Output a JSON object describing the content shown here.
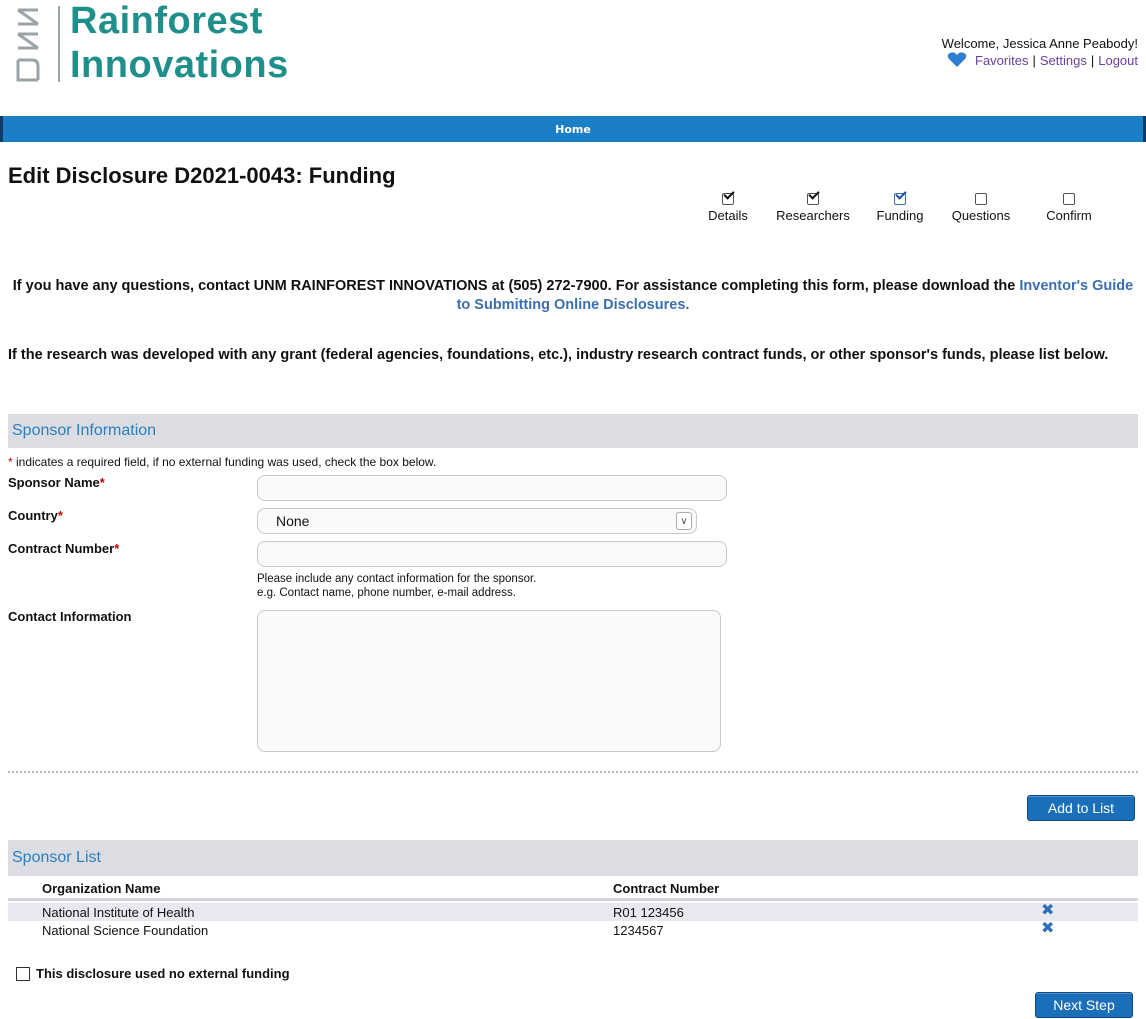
{
  "header": {
    "logo_mark": "UNM",
    "logo_line1": "Rainforest",
    "logo_line2": "Innovations",
    "welcome": "Welcome, Jessica Anne Peabody!",
    "favorites": "Favorites",
    "settings": "Settings",
    "logout": "Logout",
    "separator": "|"
  },
  "nav": {
    "home": "Home"
  },
  "page": {
    "title": "Edit Disclosure D2021-0043: Funding",
    "steps": [
      {
        "label": "Details",
        "checked": true
      },
      {
        "label": "Researchers",
        "checked": true
      },
      {
        "label": "Funding",
        "checked": true
      },
      {
        "label": "Questions",
        "checked": false
      },
      {
        "label": "Confirm",
        "checked": false
      }
    ],
    "contact_text": "If you have any questions, contact UNM RAINFOREST INNOVATIONS at (505) 272-7900. For assistance completing this form, please download the",
    "guide_link": "Inventor's Guide to Submitting Online Disclosures.",
    "instruction": "If the research was developed with any grant (federal agencies, foundations, etc.), industry research contract funds, or other sponsor's funds, please list below."
  },
  "sponsor_form": {
    "section_title": "Sponsor Information",
    "required_star": "*",
    "required_note": " indicates a required field, if no external funding was used, check the box below.",
    "sponsor_name_label": "Sponsor Name",
    "sponsor_name_value": "",
    "country_label": "Country",
    "country_value": "None",
    "contract_label": "Contract Number",
    "contract_value": "",
    "hint_line1": "Please include any contact information for the sponsor.",
    "hint_line2": "e.g. Contact name, phone number, e-mail address.",
    "contact_info_label": "Contact Information",
    "contact_info_value": "",
    "add_button": "Add to List"
  },
  "sponsor_list": {
    "section_title": "Sponsor List",
    "columns": [
      "Organization Name",
      "Contract Number"
    ],
    "rows": [
      {
        "org": "National Institute of Health",
        "contract": "R01 123456"
      },
      {
        "org": "National Science Foundation",
        "contract": "1234567"
      }
    ],
    "delete_icon": "✖"
  },
  "no_funding": {
    "label": "This disclosure used no external funding",
    "checked": false
  },
  "next_button": "Next Step",
  "colors": {
    "brand_teal": "#1e8f8a",
    "nav_blue": "#1a7fc6",
    "section_bg": "#dcdde3",
    "section_text": "#2a7fbf",
    "link_purple": "#6b3fa0",
    "button_blue": "#1a6fb8",
    "heart_blue": "#2e7fd0"
  }
}
